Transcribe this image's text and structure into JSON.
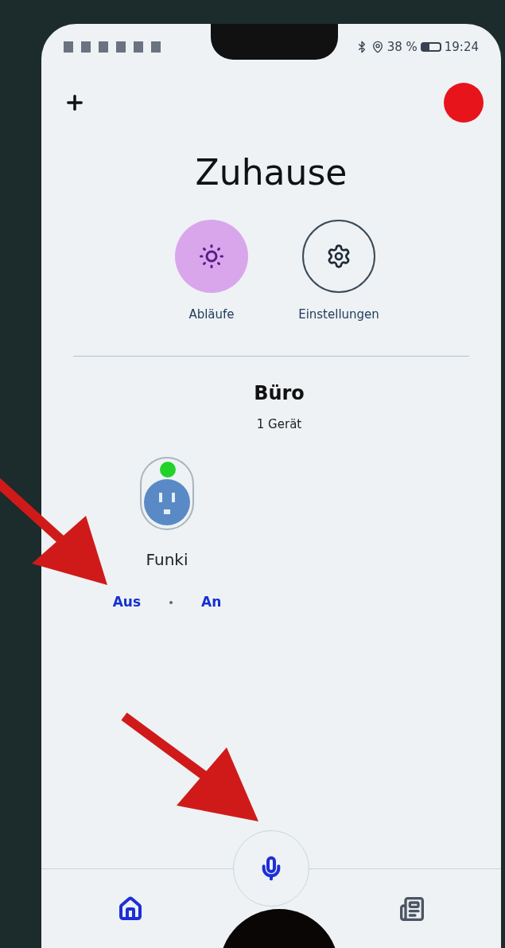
{
  "status_bar": {
    "battery": "38 %",
    "time": "19:24"
  },
  "title": "Zuhause",
  "actions": [
    {
      "kind": "routines",
      "label": "Abläufe"
    },
    {
      "kind": "settings",
      "label": "Einstellungen"
    }
  ],
  "room": {
    "name": "Büro",
    "count": "1 Gerät",
    "devices": [
      {
        "name": "Funki",
        "online": true,
        "off_label": "Aus",
        "on_label": "An"
      }
    ]
  },
  "bottom_nav": [
    {
      "kind": "home",
      "selected": true
    },
    {
      "kind": "feed",
      "selected": false
    }
  ]
}
